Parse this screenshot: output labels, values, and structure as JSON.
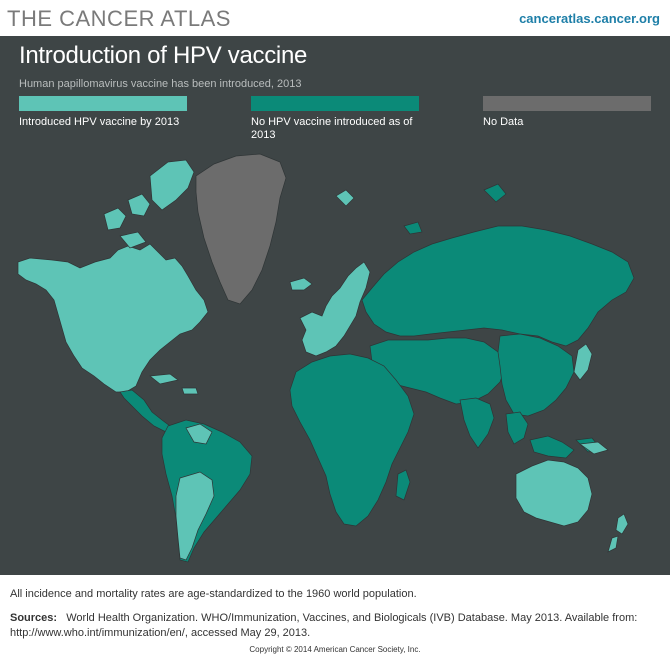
{
  "header": {
    "brand": "THE CANCER ATLAS",
    "site_link": "canceratlas.cancer.org"
  },
  "map": {
    "title": "Introduction of HPV vaccine",
    "subtitle": "Human papillomavirus vaccine has been introduced, 2013",
    "legend": [
      {
        "label": "Introduced HPV vaccine by 2013",
        "color": "#5ec4b6"
      },
      {
        "label": "No HPV vaccine introduced as of 2013",
        "color": "#0b8a78"
      },
      {
        "label": "No Data",
        "color": "#6c6c6c"
      }
    ],
    "colors": {
      "background": "#3e4546",
      "introduced": "#5ec4b6",
      "not_introduced": "#0b8a78",
      "no_data": "#6c6c6c"
    },
    "regions": [
      {
        "name": "North America",
        "status": "introduced"
      },
      {
        "name": "Greenland",
        "status": "no_data"
      },
      {
        "name": "Central America and Caribbean",
        "status": "mixed"
      },
      {
        "name": "South America",
        "status": "mixed"
      },
      {
        "name": "Western Europe",
        "status": "introduced"
      },
      {
        "name": "Eastern Europe and Russia",
        "status": "not_introduced"
      },
      {
        "name": "Africa",
        "status": "not_introduced"
      },
      {
        "name": "Middle East",
        "status": "not_introduced"
      },
      {
        "name": "Asia",
        "status": "not_introduced"
      },
      {
        "name": "Australia and New Zealand",
        "status": "introduced"
      }
    ]
  },
  "footer": {
    "note": "All incidence and mortality rates are age-standardized to the 1960 world population.",
    "sources_label": "Sources:",
    "sources_text": "World Health Organization. WHO/Immunization, Vaccines, and Biologicals (IVB) Database. May 2013. Available from: http://www.who.int/immunization/en/, accessed May 29, 2013.",
    "copyright": "Copyright © 2014 American Cancer Society, Inc."
  }
}
